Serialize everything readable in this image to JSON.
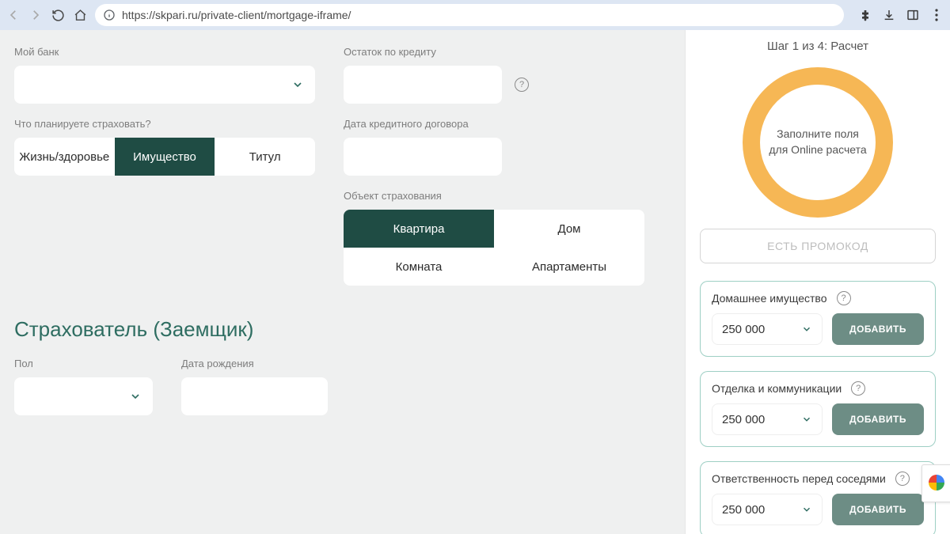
{
  "browser": {
    "url": "https://skpari.ru/private-client/mortgage-iframe/"
  },
  "form": {
    "bank_label": "Мой банк",
    "insure_label": "Что планируете страховать?",
    "insure_options": {
      "life": "Жизнь/здоровье",
      "property": "Имущество",
      "title": "Титул"
    },
    "balance_label": "Остаток по кредиту",
    "date_label": "Дата кредитного договора",
    "object_label": "Объект страхования",
    "object_options": {
      "flat": "Квартира",
      "house": "Дом",
      "room": "Комната",
      "apart": "Апартаменты"
    },
    "section_title": "Страхователь (Заемщик)",
    "gender_label": "Пол",
    "birth_label": "Дата рождения"
  },
  "side": {
    "step": "Шаг 1 из 4: Расчет",
    "circle_text": "Заполните поля для Online расчета",
    "promo": "ЕСТЬ ПРОМОКОД",
    "add": "ДОБАВИТЬ",
    "cards": [
      {
        "title": "Домашнее имущество",
        "amount": "250 000"
      },
      {
        "title": "Отделка и коммуникации",
        "amount": "250 000"
      },
      {
        "title": "Ответственность перед соседями",
        "amount": "250 000"
      }
    ]
  }
}
